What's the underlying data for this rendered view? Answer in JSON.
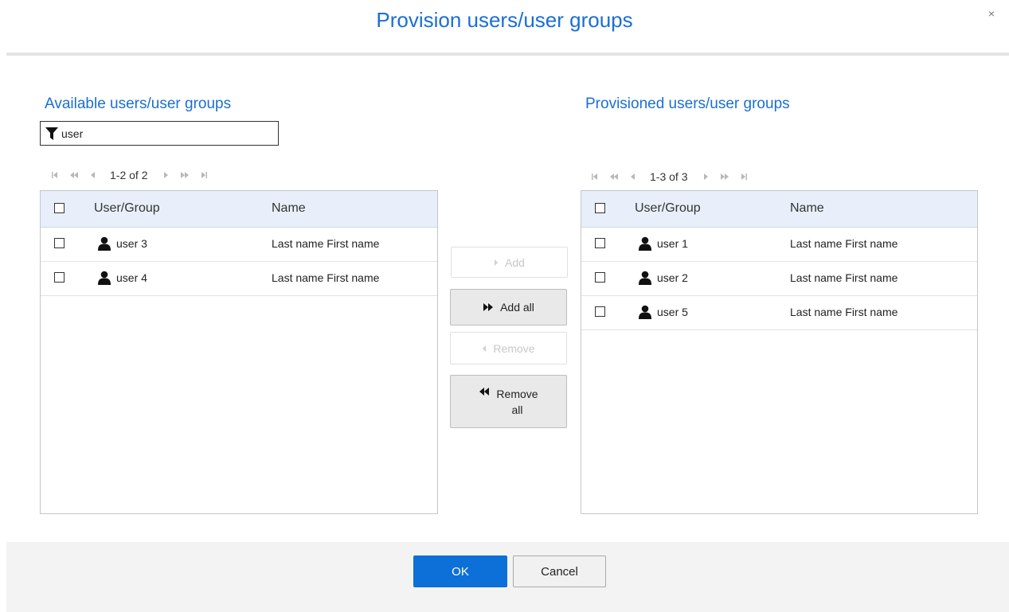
{
  "dialog": {
    "title": "Provision users/user groups",
    "close_label": "×"
  },
  "available": {
    "title": "Available users/user groups",
    "filter_value": "user",
    "pager_text": "1-2 of 2",
    "columns": [
      "User/Group",
      "Name"
    ],
    "rows": [
      {
        "user": "user 3",
        "name": "Last name First name"
      },
      {
        "user": "user 4",
        "name": "Last name First name"
      }
    ]
  },
  "provisioned": {
    "title": "Provisioned users/user groups",
    "pager_text": "1-3 of 3",
    "columns": [
      "User/Group",
      "Name"
    ],
    "rows": [
      {
        "user": "user 1",
        "name": "Last name First name"
      },
      {
        "user": "user 2",
        "name": "Last name First name"
      },
      {
        "user": "user 5",
        "name": "Last name First name"
      }
    ]
  },
  "actions": {
    "add": "Add",
    "add_all": "Add all",
    "remove": "Remove",
    "remove_all_line1": "Remove",
    "remove_all_line2": "all"
  },
  "footer": {
    "ok": "OK",
    "cancel": "Cancel"
  },
  "colors": {
    "accent": "#1a6fd4",
    "primary_button": "#0d6fd8",
    "grid_header": "#e8effa"
  }
}
